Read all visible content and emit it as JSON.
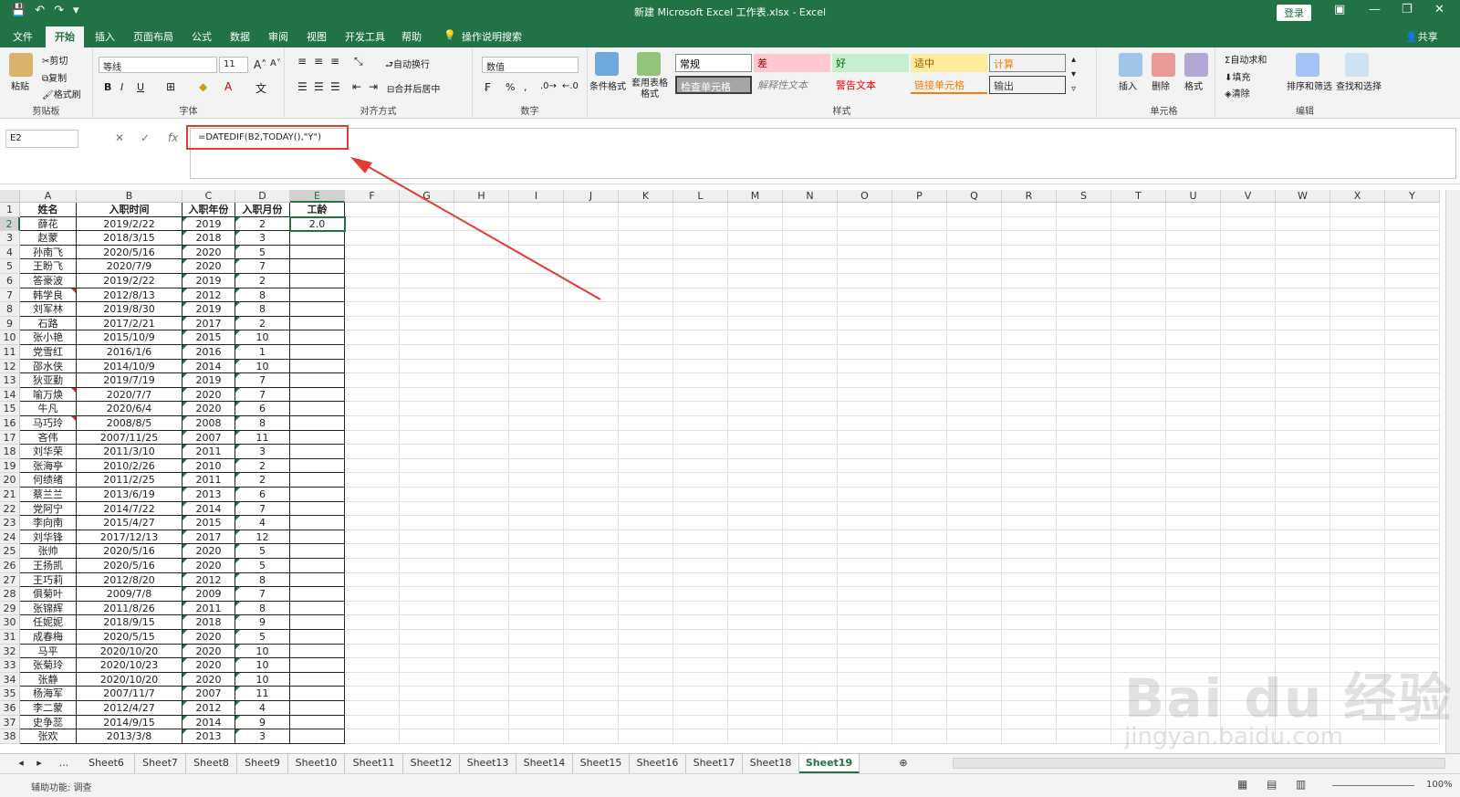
{
  "titlebar": {
    "title": "新建 Microsoft Excel 工作表.xlsx  -  Excel",
    "login": "登录"
  },
  "tabs": [
    "文件",
    "开始",
    "插入",
    "页面布局",
    "公式",
    "数据",
    "审阅",
    "视图",
    "开发工具",
    "帮助",
    "操作说明搜索"
  ],
  "share": "共享",
  "ribbon": {
    "clipboard": {
      "label": "剪贴板",
      "paste": "粘贴",
      "cut": "剪切",
      "copy": "复制",
      "format_painter": "格式刷"
    },
    "font": {
      "label": "字体",
      "name": "等线",
      "size": "11",
      "bold": "B",
      "italic": "I",
      "underline": "U"
    },
    "alignment": {
      "label": "对齐方式",
      "wrap": "自动换行",
      "merge": "合并后居中"
    },
    "number": {
      "label": "数字",
      "format": "数值",
      "percent": "%",
      "comma": ","
    },
    "styles": {
      "label": "样式",
      "conditional": "条件格式",
      "table": "套用表格格式",
      "items": [
        {
          "text": "常规",
          "bg": "#ffffff",
          "fg": "#000000"
        },
        {
          "text": "差",
          "bg": "#ffc7ce",
          "fg": "#9c0006"
        },
        {
          "text": "好",
          "bg": "#c6efce",
          "fg": "#006100"
        },
        {
          "text": "适中",
          "bg": "#ffeb9c",
          "fg": "#9c5700"
        },
        {
          "text": "计算",
          "bg": "#f2f2f2",
          "fg": "#fa7d00"
        },
        {
          "text": "检查单元格",
          "bg": "#a5a5a5",
          "fg": "#ffffff"
        },
        {
          "text": "解释性文本",
          "bg": "#f3f3f3",
          "fg": "#7f7f7f"
        },
        {
          "text": "警告文本",
          "bg": "#f3f3f3",
          "fg": "#ff0000"
        },
        {
          "text": "链接单元格",
          "bg": "#f3f3f3",
          "fg": "#fa7d00"
        },
        {
          "text": "输出",
          "bg": "#f2f2f2",
          "fg": "#3f3f3f"
        }
      ]
    },
    "cells": {
      "label": "单元格",
      "insert": "插入",
      "delete": "删除",
      "format": "格式"
    },
    "editing": {
      "label": "编辑",
      "autosum": "自动求和",
      "fill": "填充",
      "clear": "清除",
      "sort": "排序和筛选",
      "find": "查找和选择"
    }
  },
  "formula_bar": {
    "name_box": "E2",
    "fx": "fx",
    "formula": "=DATEDIF(B2,TODAY(),\"Y\")"
  },
  "columns": [
    "A",
    "B",
    "C",
    "D",
    "E",
    "F",
    "G",
    "H",
    "I",
    "J",
    "K",
    "L",
    "M",
    "N",
    "O",
    "P",
    "Q",
    "R",
    "S",
    "T",
    "U",
    "V",
    "W",
    "X",
    "Y"
  ],
  "headers": [
    "姓名",
    "入职时间",
    "入职年份",
    "入职月份",
    "工龄"
  ],
  "rows": [
    [
      "薛花",
      "2019/2/22",
      "2019",
      "2",
      "2.0"
    ],
    [
      "赵蒙",
      "2018/3/15",
      "2018",
      "3",
      ""
    ],
    [
      "孙南飞",
      "2020/5/16",
      "2020",
      "5",
      ""
    ],
    [
      "王盼飞",
      "2020/7/9",
      "2020",
      "7",
      ""
    ],
    [
      "答豪波",
      "2019/2/22",
      "2019",
      "2",
      ""
    ],
    [
      "韩学良",
      "2012/8/13",
      "2012",
      "8",
      ""
    ],
    [
      "刘军林",
      "2019/8/30",
      "2019",
      "8",
      ""
    ],
    [
      "石路",
      "2017/2/21",
      "2017",
      "2",
      ""
    ],
    [
      "张小艳",
      "2015/10/9",
      "2015",
      "10",
      ""
    ],
    [
      "党雪红",
      "2016/1/6",
      "2016",
      "1",
      ""
    ],
    [
      "邵水侠",
      "2014/10/9",
      "2014",
      "10",
      ""
    ],
    [
      "狄亚勤",
      "2019/7/19",
      "2019",
      "7",
      ""
    ],
    [
      "喻万焕",
      "2020/7/7",
      "2020",
      "7",
      ""
    ],
    [
      "牛凡",
      "2020/6/4",
      "2020",
      "6",
      ""
    ],
    [
      "马巧玲",
      "2008/8/5",
      "2008",
      "8",
      ""
    ],
    [
      "吝伟",
      "2007/11/25",
      "2007",
      "11",
      ""
    ],
    [
      "刘华荣",
      "2011/3/10",
      "2011",
      "3",
      ""
    ],
    [
      "张海亭",
      "2010/2/26",
      "2010",
      "2",
      ""
    ],
    [
      "何绩绪",
      "2011/2/25",
      "2011",
      "2",
      ""
    ],
    [
      "蔡兰兰",
      "2013/6/19",
      "2013",
      "6",
      ""
    ],
    [
      "党阿宁",
      "2014/7/22",
      "2014",
      "7",
      ""
    ],
    [
      "李向南",
      "2015/4/27",
      "2015",
      "4",
      ""
    ],
    [
      "刘华锋",
      "2017/12/13",
      "2017",
      "12",
      ""
    ],
    [
      "张帅",
      "2020/5/16",
      "2020",
      "5",
      ""
    ],
    [
      "王扬凯",
      "2020/5/16",
      "2020",
      "5",
      ""
    ],
    [
      "王巧莉",
      "2012/8/20",
      "2012",
      "8",
      ""
    ],
    [
      "俱菊叶",
      "2009/7/8",
      "2009",
      "7",
      ""
    ],
    [
      "张锦辉",
      "2011/8/26",
      "2011",
      "8",
      ""
    ],
    [
      "任妮妮",
      "2018/9/15",
      "2018",
      "9",
      ""
    ],
    [
      "成春梅",
      "2020/5/15",
      "2020",
      "5",
      ""
    ],
    [
      "马平",
      "2020/10/20",
      "2020",
      "10",
      ""
    ],
    [
      "张菊玲",
      "2020/10/23",
      "2020",
      "10",
      ""
    ],
    [
      "张静",
      "2020/10/20",
      "2020",
      "10",
      ""
    ],
    [
      "杨海军",
      "2007/11/7",
      "2007",
      "11",
      ""
    ],
    [
      "李二蒙",
      "2012/4/27",
      "2012",
      "4",
      ""
    ],
    [
      "史争蕊",
      "2014/9/15",
      "2014",
      "9",
      ""
    ],
    [
      "张欢",
      "2013/3/8",
      "2013",
      "3",
      ""
    ]
  ],
  "sheets": [
    "Sheet6",
    "Sheet7",
    "Sheet8",
    "Sheet9",
    "Sheet10",
    "Sheet11",
    "Sheet12",
    "Sheet13",
    "Sheet14",
    "Sheet15",
    "Sheet16",
    "Sheet17",
    "Sheet18",
    "Sheet19"
  ],
  "active_sheet": "Sheet19",
  "sheet_ellipsis": "...",
  "status": {
    "accessibility": "辅助功能: 调查",
    "zoom": "100%"
  },
  "watermark": {
    "main": "Bai du 经验",
    "sub": "jingyan.baidu.com"
  }
}
